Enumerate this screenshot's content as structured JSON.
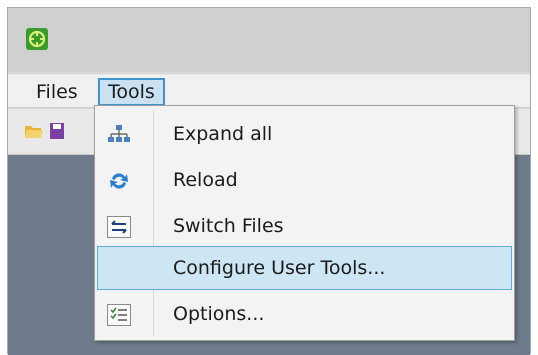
{
  "menubar": {
    "files_label": "Files",
    "tools_label": "Tools"
  },
  "tools_menu": {
    "items": [
      {
        "label": "Expand all",
        "icon": "expand-all-icon"
      },
      {
        "label": "Reload",
        "icon": "reload-icon"
      },
      {
        "label": "Switch Files",
        "icon": "switch-files-icon"
      },
      {
        "label": "Configure User Tools...",
        "icon": "",
        "highlighted": true
      },
      {
        "label": "Options...",
        "icon": "options-icon"
      }
    ]
  },
  "colors": {
    "menu_highlight": "#cde6f4",
    "menu_highlight_border": "#5da9da",
    "content_background": "#6e7b8b"
  }
}
